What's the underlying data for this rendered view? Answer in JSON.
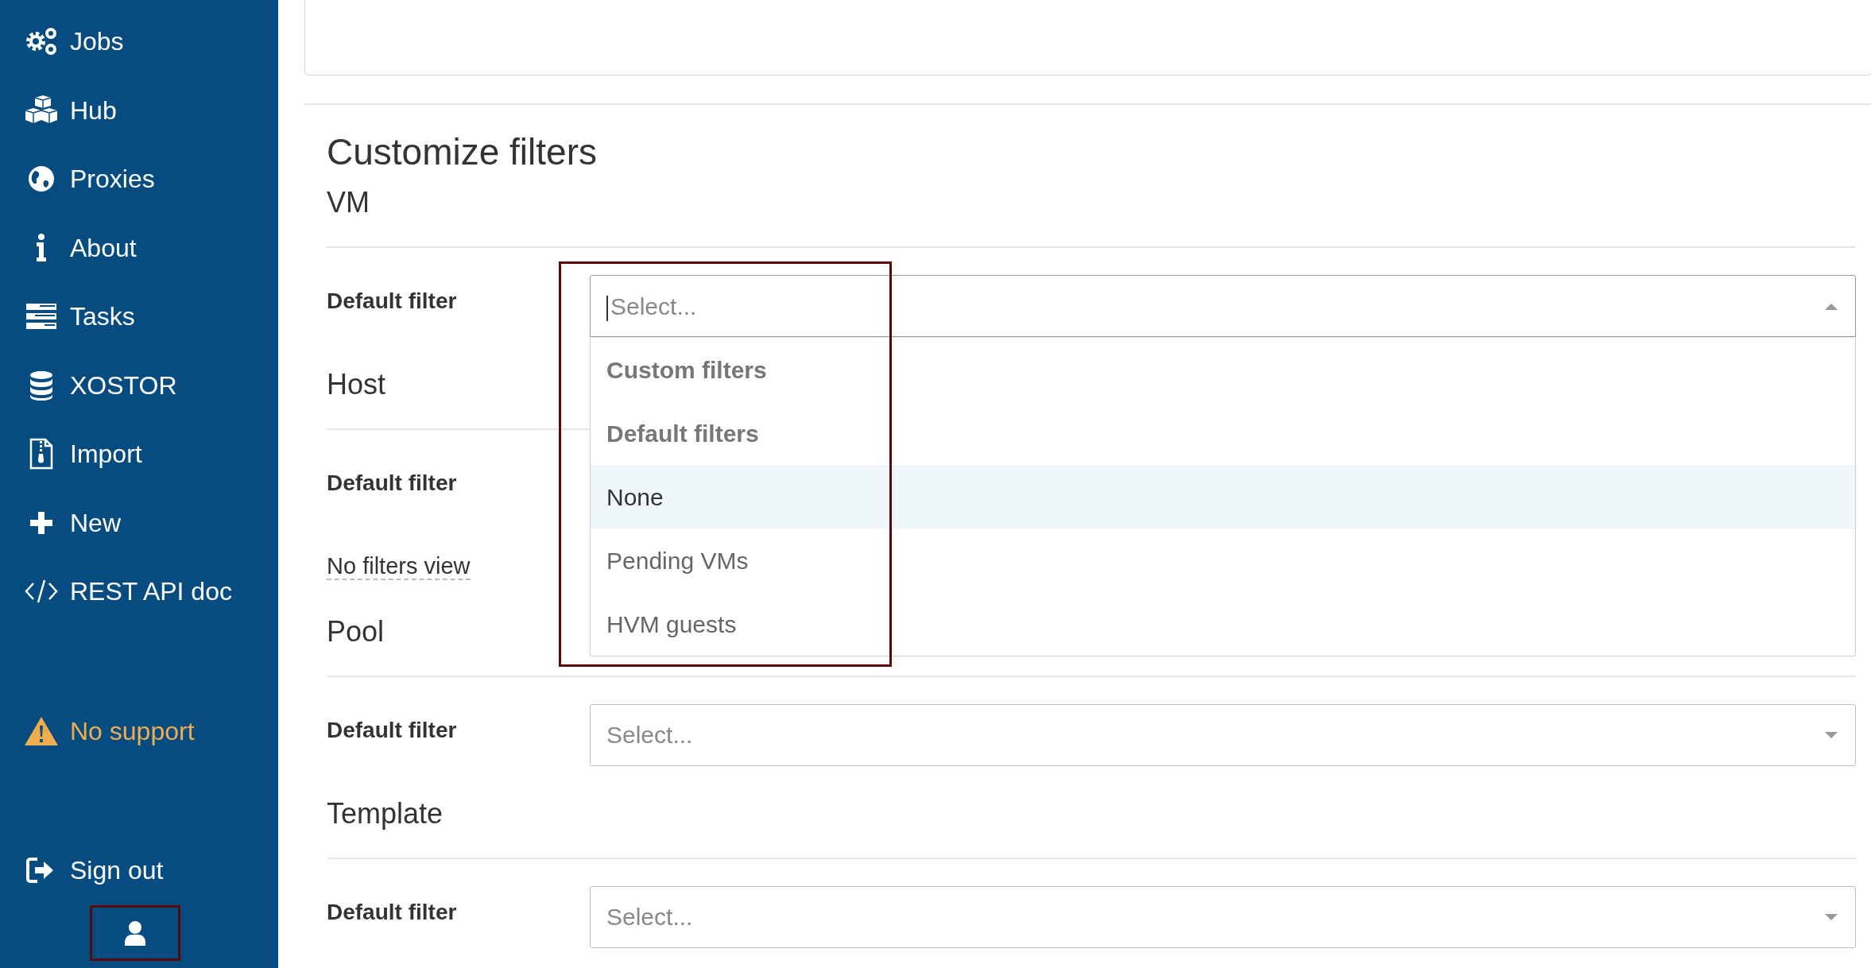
{
  "sidebar": {
    "items": [
      {
        "label": "Jobs"
      },
      {
        "label": "Hub"
      },
      {
        "label": "Proxies"
      },
      {
        "label": "About"
      },
      {
        "label": "Tasks"
      },
      {
        "label": "XOSTOR"
      },
      {
        "label": "Import"
      },
      {
        "label": "New"
      },
      {
        "label": "REST API doc"
      }
    ],
    "support": {
      "label": "No support"
    },
    "sign_out": {
      "label": "Sign out"
    }
  },
  "main": {
    "title": "Customize filters",
    "sections": [
      {
        "title": "VM",
        "field_label": "Default filter",
        "placeholder": "Select...",
        "open": true,
        "options": [
          {
            "label": "Custom filters",
            "kind": "group",
            "selected": false
          },
          {
            "label": "Default filters",
            "kind": "group",
            "selected": false
          },
          {
            "label": "None",
            "kind": "option",
            "selected": true
          },
          {
            "label": "Pending VMs",
            "kind": "option",
            "selected": false
          },
          {
            "label": "HVM guests",
            "kind": "option",
            "selected": false
          }
        ]
      },
      {
        "title": "Host",
        "field_label": "Default filter",
        "link": "No filters view"
      },
      {
        "title": "Pool",
        "field_label": "Default filter",
        "placeholder": "Select...",
        "open": false
      },
      {
        "title": "Template",
        "field_label": "Default filter",
        "placeholder": "Select...",
        "open": false
      }
    ]
  }
}
